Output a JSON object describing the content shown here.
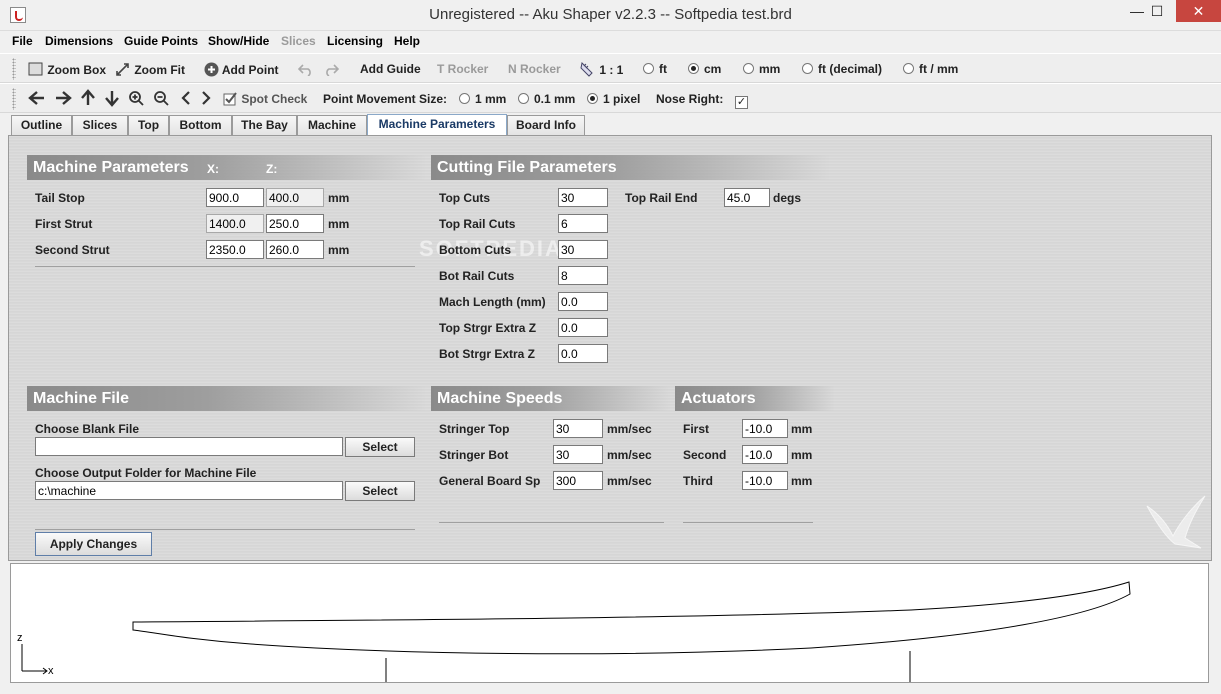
{
  "window": {
    "title": "Unregistered -- Aku Shaper v2.2.3  --  Softpedia test.brd",
    "minimize": "—",
    "maximize": "☐",
    "close": "✕"
  },
  "menu": [
    {
      "label": "File",
      "enabled": true
    },
    {
      "label": "Dimensions",
      "enabled": true
    },
    {
      "label": "Guide Points",
      "enabled": true
    },
    {
      "label": "Show/Hide",
      "enabled": true
    },
    {
      "label": "Slices",
      "enabled": false
    },
    {
      "label": "Licensing",
      "enabled": true
    },
    {
      "label": "Help",
      "enabled": true
    }
  ],
  "toolbar1": {
    "zoom_box": "Zoom Box",
    "zoom_fit": "Zoom Fit",
    "add_point": "Add Point",
    "add_guide": "Add Guide",
    "t_rocker": "T Rocker",
    "n_rocker": "N Rocker",
    "scale": "1 : 1",
    "units": [
      {
        "label": "ft",
        "selected": false
      },
      {
        "label": "cm",
        "selected": true
      },
      {
        "label": "mm",
        "selected": false
      },
      {
        "label": "ft (decimal)",
        "selected": false
      },
      {
        "label": "ft / mm",
        "selected": false
      }
    ]
  },
  "toolbar2": {
    "spot_check": "Spot Check",
    "movement_label": "Point Movement Size:",
    "movement": [
      {
        "label": "1 mm",
        "selected": false
      },
      {
        "label": "0.1 mm",
        "selected": false
      },
      {
        "label": "1 pixel",
        "selected": true
      }
    ],
    "nose_right_label": "Nose Right:",
    "nose_right_checked": true,
    "check_mark": "✓"
  },
  "tabs": [
    {
      "label": "Outline",
      "active": false
    },
    {
      "label": "Slices",
      "active": false
    },
    {
      "label": "Top",
      "active": false
    },
    {
      "label": "Bottom",
      "active": false
    },
    {
      "label": "The Bay",
      "active": false
    },
    {
      "label": "Machine",
      "active": false
    },
    {
      "label": "Machine Parameters",
      "active": true
    },
    {
      "label": "Board Info",
      "active": false
    }
  ],
  "machine_params": {
    "title": "Machine Parameters",
    "x_label": "X:",
    "z_label": "Z:",
    "unit": "mm",
    "rows": [
      {
        "label": "Tail Stop",
        "x": "900.0",
        "z": "400.0"
      },
      {
        "label": "First Strut",
        "x": "1400.0",
        "z": "250.0"
      },
      {
        "label": "Second Strut",
        "x": "2350.0",
        "z": "260.0"
      }
    ]
  },
  "cutting": {
    "title": "Cutting File Parameters",
    "rows": [
      {
        "label": "Top Cuts",
        "value": "30"
      },
      {
        "label": "Top Rail Cuts",
        "value": "6"
      },
      {
        "label": "Bottom Cuts",
        "value": "30"
      },
      {
        "label": "Bot Rail Cuts",
        "value": "8"
      },
      {
        "label": "Mach Length (mm)",
        "value": "0.0"
      },
      {
        "label": "Top Strgr Extra Z",
        "value": "0.0"
      },
      {
        "label": "Bot Strgr Extra Z",
        "value": "0.0"
      }
    ],
    "top_rail_end_label": "Top Rail End",
    "top_rail_end_value": "45.0",
    "top_rail_end_unit": "degs"
  },
  "machine_file": {
    "title": "Machine File",
    "blank_label": "Choose Blank File",
    "blank_value": "",
    "select": "Select",
    "output_label": "Choose Output Folder for Machine File",
    "output_value": "c:\\machine"
  },
  "speeds": {
    "title": "Machine Speeds",
    "unit": "mm/sec",
    "rows": [
      {
        "label": "Stringer Top",
        "value": "30"
      },
      {
        "label": "Stringer Bot",
        "value": "30"
      },
      {
        "label": "General Board Sp",
        "value": "300"
      }
    ]
  },
  "actuators": {
    "title": "Actuators",
    "unit": "mm",
    "rows": [
      {
        "label": "First",
        "value": "-10.0"
      },
      {
        "label": "Second",
        "value": "-10.0"
      },
      {
        "label": "Third",
        "value": "-10.0"
      }
    ]
  },
  "apply_changes": "Apply Changes",
  "watermark": "SOFTPEDIA",
  "axes": {
    "z": "z",
    "x": "x"
  }
}
